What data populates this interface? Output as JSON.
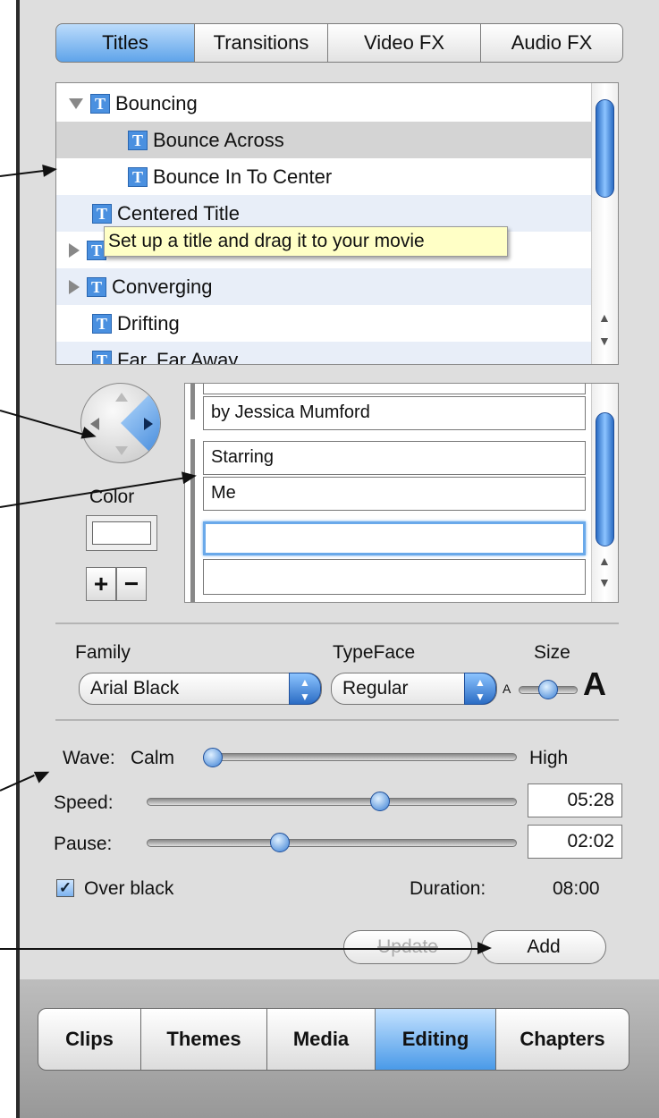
{
  "tabs_top": [
    "Titles",
    "Transitions",
    "Video FX",
    "Audio FX"
  ],
  "title_list": [
    {
      "label": "Bouncing",
      "indent": 0,
      "expander": "expanded"
    },
    {
      "label": "Bounce Across",
      "indent": 1,
      "expander": "none",
      "selected": true
    },
    {
      "label": "Bounce In To Center",
      "indent": 1,
      "expander": "none"
    },
    {
      "label": "Centered Title",
      "indent": 0,
      "expander": "none"
    },
    {
      "label": "",
      "indent": 0,
      "expander": "collapsed"
    },
    {
      "label": "Converging",
      "indent": 0,
      "expander": "collapsed"
    },
    {
      "label": "Drifting",
      "indent": 0,
      "expander": "none"
    },
    {
      "label": "Far, Far Away",
      "indent": 0,
      "expander": "none"
    }
  ],
  "tooltip": "Set up a title and drag it to your movie",
  "text_lines": [
    "by Jessica Mumford",
    "Starring",
    "Me",
    ""
  ],
  "color_label": "Color",
  "plus_label": "+",
  "minus_label": "−",
  "font": {
    "family_label": "Family",
    "family_value": "Arial Black",
    "typeface_label": "TypeFace",
    "typeface_value": "Regular",
    "size_label": "Size",
    "size_small": "A",
    "size_large": "A",
    "size_level": 0.5
  },
  "wave": {
    "label": "Wave:",
    "min_label": "Calm",
    "max_label": "High",
    "level": 0.0
  },
  "speed": {
    "label": "Speed:",
    "value": "05:28",
    "level": 0.63
  },
  "pause": {
    "label": "Pause:",
    "value": "02:02",
    "level": 0.36
  },
  "over_black": {
    "label": "Over black",
    "checked": true
  },
  "duration": {
    "label": "Duration:",
    "value": "08:00"
  },
  "buttons": {
    "update": "Update",
    "add": "Add"
  },
  "tabs_bottom": [
    "Clips",
    "Themes",
    "Media",
    "Editing",
    "Chapters"
  ],
  "colors": {
    "accent": "#4a9ae8",
    "tooltip_bg": "#ffffc6"
  }
}
